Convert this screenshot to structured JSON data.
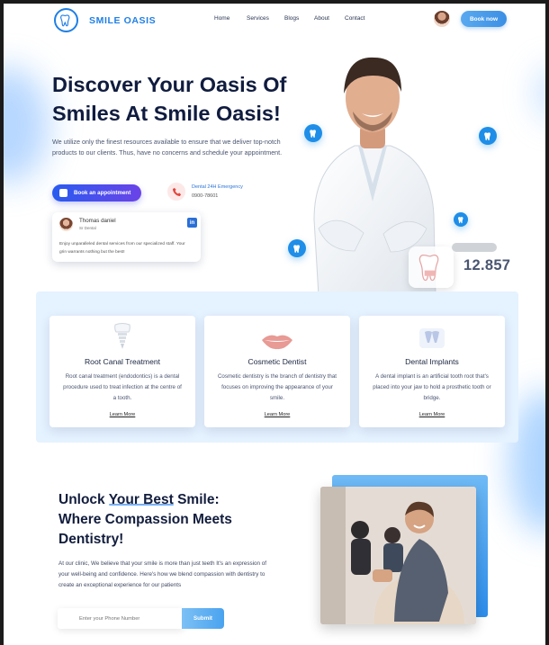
{
  "brand": {
    "name": "SMILE OASIS"
  },
  "nav": {
    "items": [
      "Home",
      "Services",
      "Blogs",
      "About",
      "Contact"
    ]
  },
  "header": {
    "book_label": "Book now"
  },
  "hero": {
    "title": "Discover Your Oasis Of Smiles At Smile Oasis!",
    "description": "We utilize only the finest resources available to ensure that we deliver top-notch products to our clients. Thus, have no concerns and schedule your appointment.",
    "appointment_label": "Book an appointment",
    "emergency_label": "Dental 24H Emergency",
    "emergency_phone": "0900-78601"
  },
  "review": {
    "name": "Thomas daniel",
    "role": "Sr Dental",
    "text": "Enjoy unparalleled dental services from our specialized staff. Your grin warrants nothing but the best!"
  },
  "stat": {
    "value": "12.857"
  },
  "services": [
    {
      "title": "Root Canal Treatment",
      "description": "Root canal treatment (endodontics) is a dental procedure used to treat infection at the centre of a tooth.",
      "link": "Learn More",
      "icon": "tooth-implant-icon"
    },
    {
      "title": "Cosmetic Dentist",
      "description": "Cosmetic dentistry is the branch of dentistry that focuses on improving the appearance of your smile.",
      "link": "Learn More",
      "icon": "lips-icon"
    },
    {
      "title": "Dental Implants",
      "description": "A dental implant is an artificial tooth root that's placed into your jaw to hold a prosthetic tooth or bridge.",
      "link": "Learn More",
      "icon": "dental-implants-icon"
    }
  ],
  "bottom": {
    "title_line1": "Unlock",
    "title_highlight": "Your Best",
    "title_line1_end": "Smile:",
    "title_line2": "Where Compassion Meets Dentistry!",
    "description": "At our clinic, We believe that your smile is more than just teeth It's an expression of your well-being and confidence. Here's how we blend compassion with dentistry to create an exceptional experience for our patients",
    "input_placeholder": "Enter your Phone Number",
    "submit_label": "Submit"
  },
  "colors": {
    "primary": "#1f7fe6",
    "accent_gradient_start": "#2a5bf0",
    "accent_gradient_end": "#6a43e8",
    "band_bg": "#e5f2ff"
  }
}
